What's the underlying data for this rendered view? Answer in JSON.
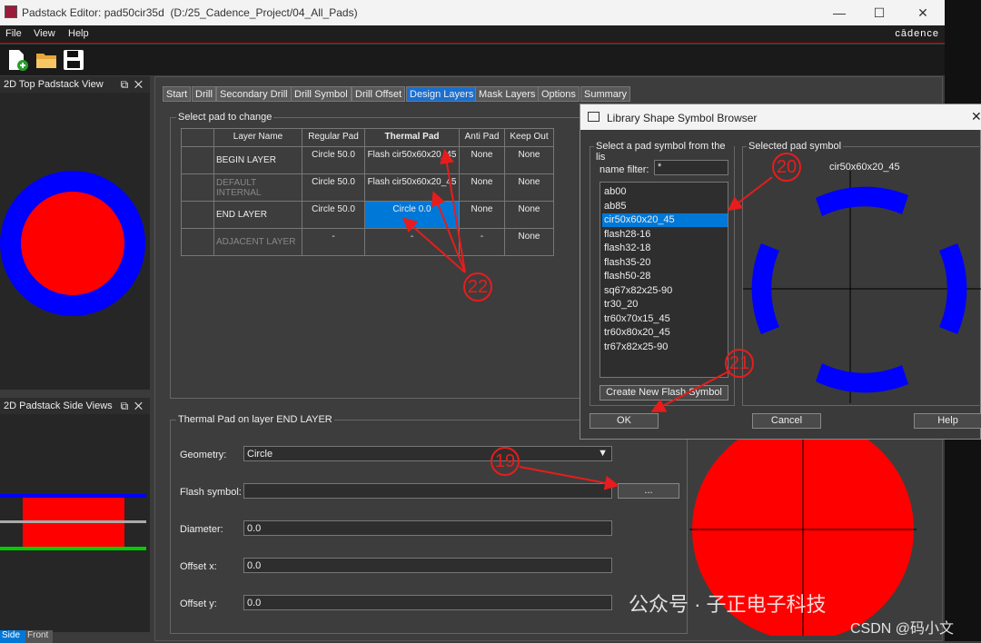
{
  "window": {
    "title": "Padstack Editor: pad50cir35d",
    "path": "(D:/25_Cadence_Project/04_All_Pads)",
    "brand": "cādence"
  },
  "menu": [
    "File",
    "View",
    "Help"
  ],
  "panels": {
    "top_view_title": "2D Top Padstack View",
    "side_view_title": "2D Padstack Side Views",
    "bottom_tabs": [
      "Side",
      "Front"
    ]
  },
  "tabs": [
    "Start",
    "Drill",
    "Secondary Drill",
    "Drill Symbol",
    "Drill Offset",
    "Design Layers",
    "Mask Layers",
    "Options",
    "Summary"
  ],
  "active_tab": "Design Layers",
  "select_pad": {
    "group_label": "Select pad to change",
    "headers": [
      "Layer Name",
      "Regular Pad",
      "Thermal Pad",
      "Anti Pad",
      "Keep Out"
    ],
    "rows": [
      {
        "name": "BEGIN LAYER",
        "regular": "Circle 50.0",
        "thermal": "Flash cir50x60x20_45",
        "anti": "None",
        "keep": "None"
      },
      {
        "name": "DEFAULT INTERNAL",
        "regular": "Circle 50.0",
        "thermal": "Flash cir50x60x20_45",
        "anti": "None",
        "keep": "None"
      },
      {
        "name": "END LAYER",
        "regular": "Circle 50.0",
        "thermal": "Circle 0.0",
        "anti": "None",
        "keep": "None"
      },
      {
        "name": "ADJACENT LAYER",
        "regular": "-",
        "thermal": "-",
        "anti": "-",
        "keep": "None"
      }
    ]
  },
  "thermal_group": {
    "label": "Thermal Pad on layer END LAYER",
    "geometry_label": "Geometry:",
    "geometry_value": "Circle",
    "flash_label": "Flash symbol:",
    "flash_value": "",
    "browse_btn": "...",
    "diameter_label": "Diameter:",
    "diameter_value": "0.0",
    "offx_label": "Offset x:",
    "offx_value": "0.0",
    "offy_label": "Offset y:",
    "offy_value": "0.0"
  },
  "dialog": {
    "title": "Library Shape Symbol Browser",
    "list_group": "Select a pad symbol from the lis",
    "filter_label": "name filter:",
    "filter_value": "*",
    "items": [
      "ab00",
      "ab85",
      "cir50x60x20_45",
      "flash28-16",
      "flash32-18",
      "flash35-20",
      "flash50-28",
      "sq67x82x25-90",
      "tr30_20",
      "tr60x70x15_45",
      "tr60x80x20_45",
      "tr67x82x25-90"
    ],
    "selected_index": 2,
    "create_btn": "Create New Flash Symbol",
    "preview_group": "Selected pad symbol",
    "preview_name": "cir50x60x20_45",
    "ok": "OK",
    "cancel": "Cancel",
    "help": "Help"
  },
  "annotations": [
    "19",
    "20",
    "21",
    "22"
  ],
  "watermark": "公众号 · 子正电子科技",
  "csdn": "CSDN @码小文",
  "colors": {
    "accent": "#0078d7",
    "pad_red": "#ff0000",
    "pad_blue": "#0000ff",
    "annotation": "#e81c1c"
  }
}
